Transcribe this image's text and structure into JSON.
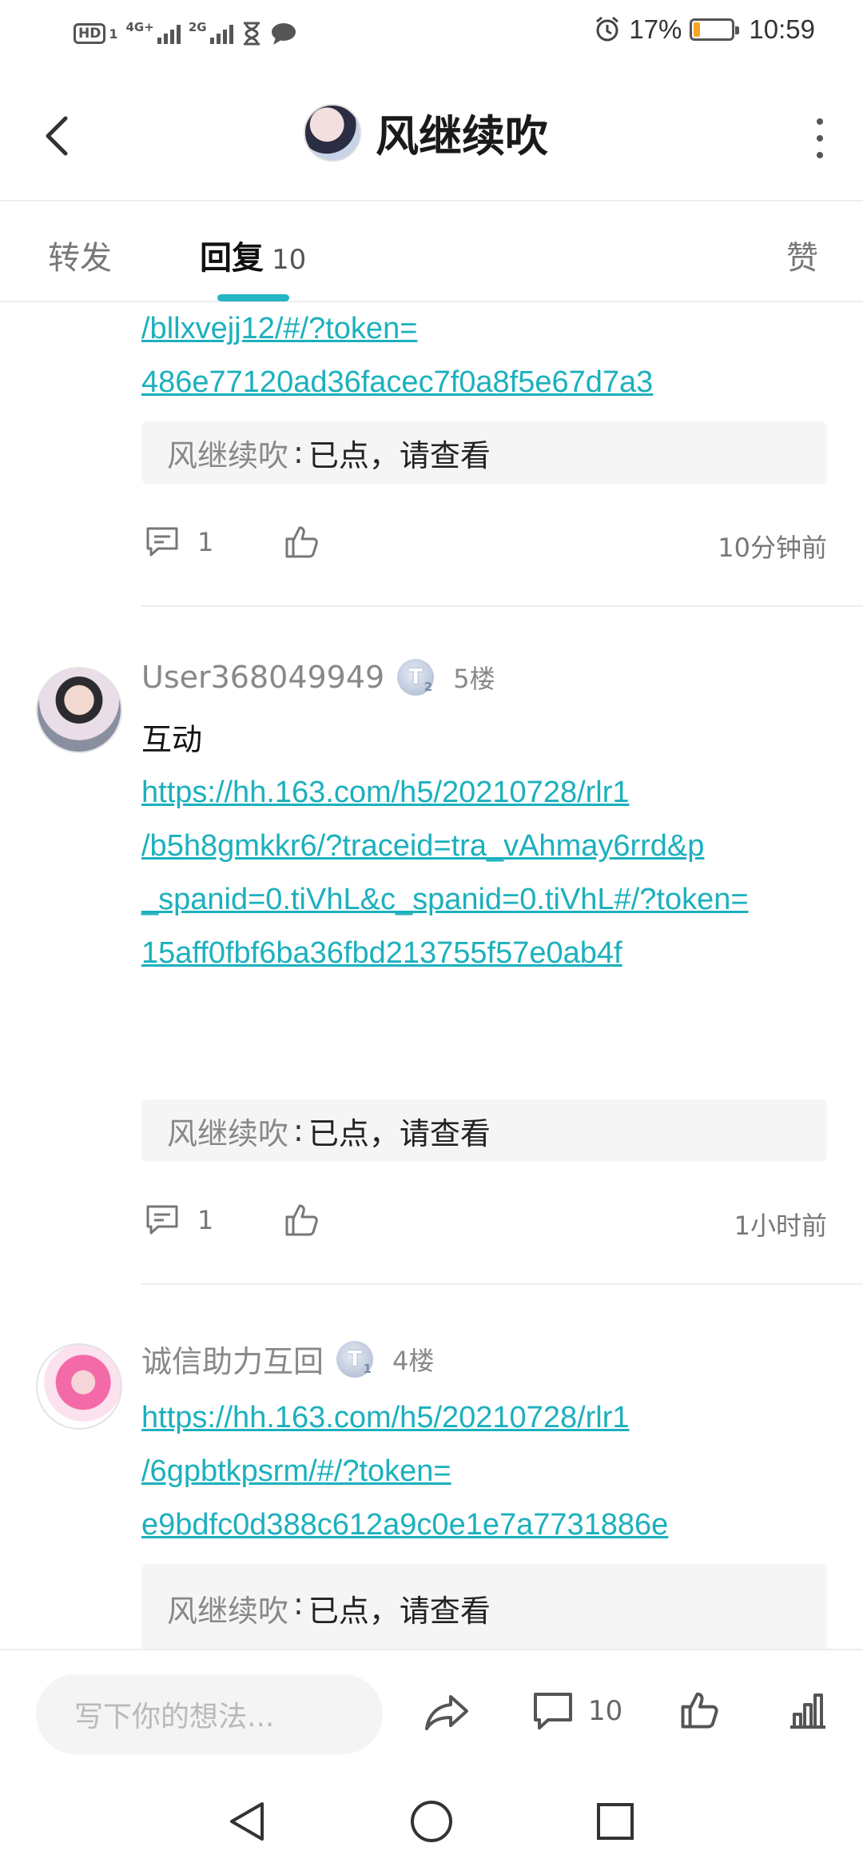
{
  "status_bar": {
    "hd_badge": "HD",
    "sim1": "1",
    "network1": "4G+",
    "network2": "2G",
    "battery_percent": "17%",
    "battery_level": 0.17,
    "time": "10:59"
  },
  "header": {
    "title": "风继续吹"
  },
  "tabs": {
    "repost": "转发",
    "reply": "回复",
    "reply_count": "10",
    "like": "赞"
  },
  "posts": [
    {
      "link_lines": [
        "/bllxvejj12/#/?token=",
        "486e77120ad36facec7f0a8f5e67d7a3"
      ],
      "quote": {
        "name": "风继续吹",
        "sep": ":",
        "text": "已点，请查看"
      },
      "comment_count": "1",
      "time": "10分钟前"
    },
    {
      "username": "User368049949",
      "level": "T",
      "level_sub": "2",
      "floor": "5楼",
      "text": "互动",
      "link_lines": [
        "https://hh.163.com/h5/20210728/rlr1",
        "/b5h8gmkkr6/?traceid=tra_vAhmay6rrd&p",
        "_spanid=0.tiVhL&c_spanid=0.tiVhL#/?token=",
        "15aff0fbf6ba36fbd213755f57e0ab4f"
      ],
      "quote": {
        "name": "风继续吹",
        "sep": ":",
        "text": "已点，请查看"
      },
      "comment_count": "1",
      "time": "1小时前"
    },
    {
      "username": "诚信助力互回",
      "level": "T",
      "level_sub": "1",
      "floor": "4楼",
      "link_lines": [
        "https://hh.163.com/h5/20210728/rlr1",
        "/6gpbtkpsrm/#/?token=",
        "e9bdfc0d388c612a9c0e1e7a7731886e"
      ],
      "quote": {
        "name": "风继续吹",
        "sep": ":",
        "text": "已点，请查看"
      }
    }
  ],
  "bottom_bar": {
    "input_placeholder": "写下你的想法...",
    "comment_count": "10"
  },
  "colors": {
    "accent": "#1cb0bd",
    "tab_indicator": "#26b5c3",
    "battery_fill": "#f5a623"
  }
}
